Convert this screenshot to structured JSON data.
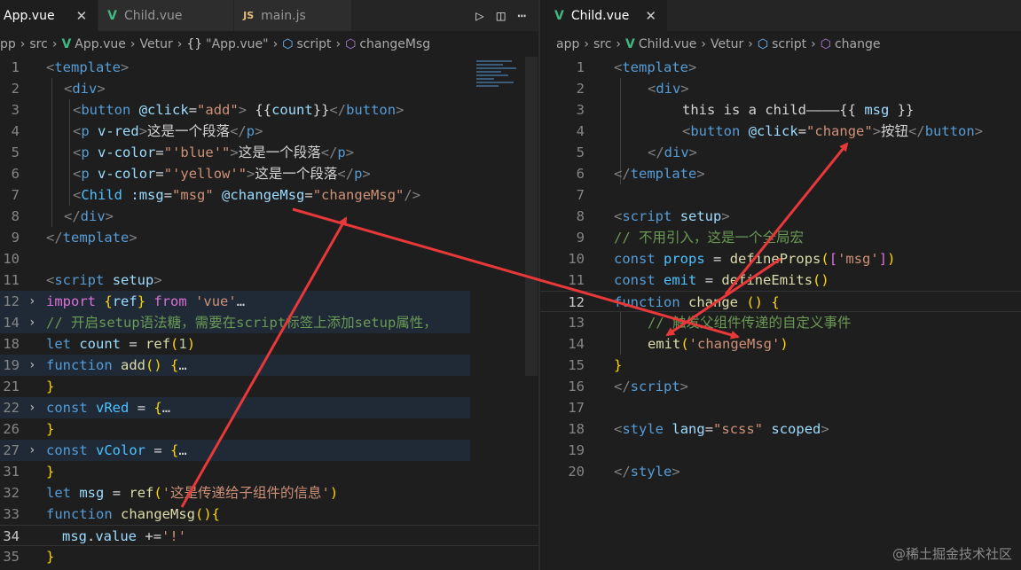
{
  "left": {
    "tabs": [
      {
        "label": "App.vue",
        "icon": "vue-icon",
        "close": "✕",
        "active": true
      },
      {
        "label": "Child.vue",
        "icon": "vue-icon",
        "active": false
      },
      {
        "label": "main.js",
        "icon": "js-icon",
        "icon_text": "JS",
        "active": false
      }
    ],
    "actions": {
      "run": "▷",
      "split": "◫",
      "more": "⋯"
    },
    "breadcrumb": [
      "pp",
      "src",
      "App.vue",
      "Vetur",
      "\"App.vue\"",
      "script",
      "changeMsg"
    ]
  },
  "right": {
    "tabs": [
      {
        "label": "Child.vue",
        "icon": "vue-icon",
        "close": "✕",
        "active": true
      }
    ],
    "breadcrumb": [
      "app",
      "src",
      "Child.vue",
      "Vetur",
      "script",
      "change"
    ]
  },
  "watermark": "@稀土掘金技术社区",
  "colors": {
    "background": "#1e1e1e",
    "tab_bar": "#252526",
    "keyword": "#569cd6",
    "string": "#ce9178",
    "comment": "#6a9955",
    "function": "#dcdcaa",
    "arrow": "#e8383a"
  }
}
